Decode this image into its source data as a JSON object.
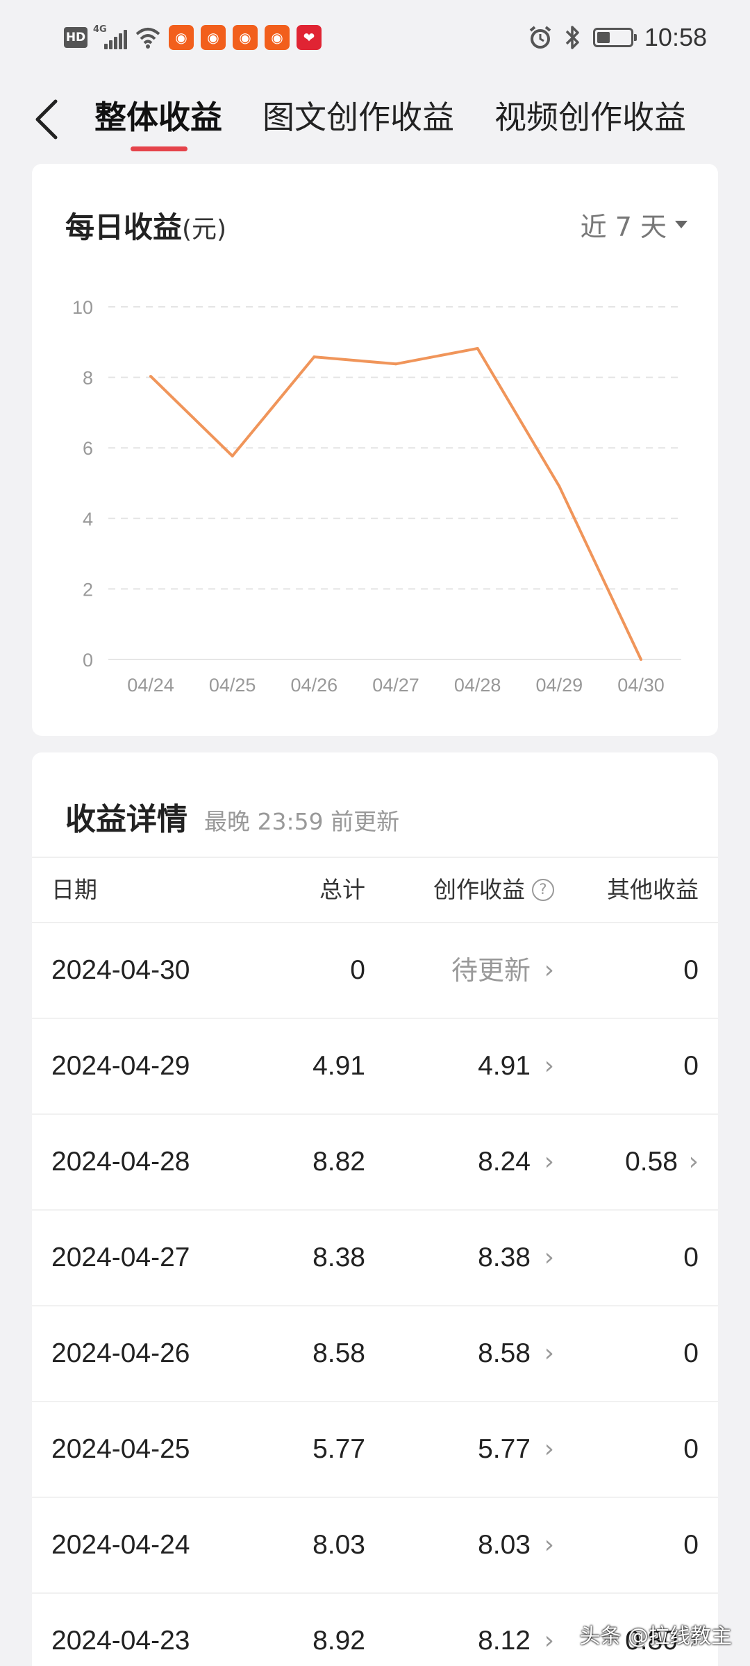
{
  "status_bar": {
    "hd": "HD",
    "network": "4G",
    "time": "10:58",
    "battery_level_percent": 40
  },
  "nav": {
    "tabs": [
      {
        "label": "整体收益",
        "active": true
      },
      {
        "label": "图文创作收益",
        "active": false
      },
      {
        "label": "视频创作收益",
        "active": false
      }
    ]
  },
  "chart_card": {
    "title": "每日收益",
    "unit": "(元)",
    "range": "近 7 天"
  },
  "chart_data": {
    "type": "line",
    "x": [
      "04/24",
      "04/25",
      "04/26",
      "04/27",
      "04/28",
      "04/29",
      "04/30"
    ],
    "y": [
      8.03,
      5.77,
      8.58,
      8.38,
      8.82,
      4.91,
      0
    ],
    "yticks": [
      "0",
      "2",
      "4",
      "6",
      "8",
      "10"
    ],
    "ylim": [
      0,
      10
    ],
    "grid": true,
    "color": "#f0955a"
  },
  "detail": {
    "title": "收益详情",
    "subtitle": "最晚 23:59 前更新",
    "columns": {
      "date": "日期",
      "total": "总计",
      "create": "创作收益",
      "other": "其他收益"
    },
    "help_glyph": "?",
    "rows": [
      {
        "date": "2024-04-30",
        "total": "0",
        "create": "待更新",
        "other": "0"
      },
      {
        "date": "2024-04-29",
        "total": "4.91",
        "create": "4.91",
        "other": "0"
      },
      {
        "date": "2024-04-28",
        "total": "8.82",
        "create": "8.24",
        "other": "0.58"
      },
      {
        "date": "2024-04-27",
        "total": "8.38",
        "create": "8.38",
        "other": "0"
      },
      {
        "date": "2024-04-26",
        "total": "8.58",
        "create": "8.58",
        "other": "0"
      },
      {
        "date": "2024-04-25",
        "total": "5.77",
        "create": "5.77",
        "other": "0"
      },
      {
        "date": "2024-04-24",
        "total": "8.03",
        "create": "8.03",
        "other": "0"
      },
      {
        "date": "2024-04-23",
        "total": "8.92",
        "create": "8.12",
        "other": "0.80"
      }
    ]
  },
  "watermark": "头条 @拉线教主"
}
